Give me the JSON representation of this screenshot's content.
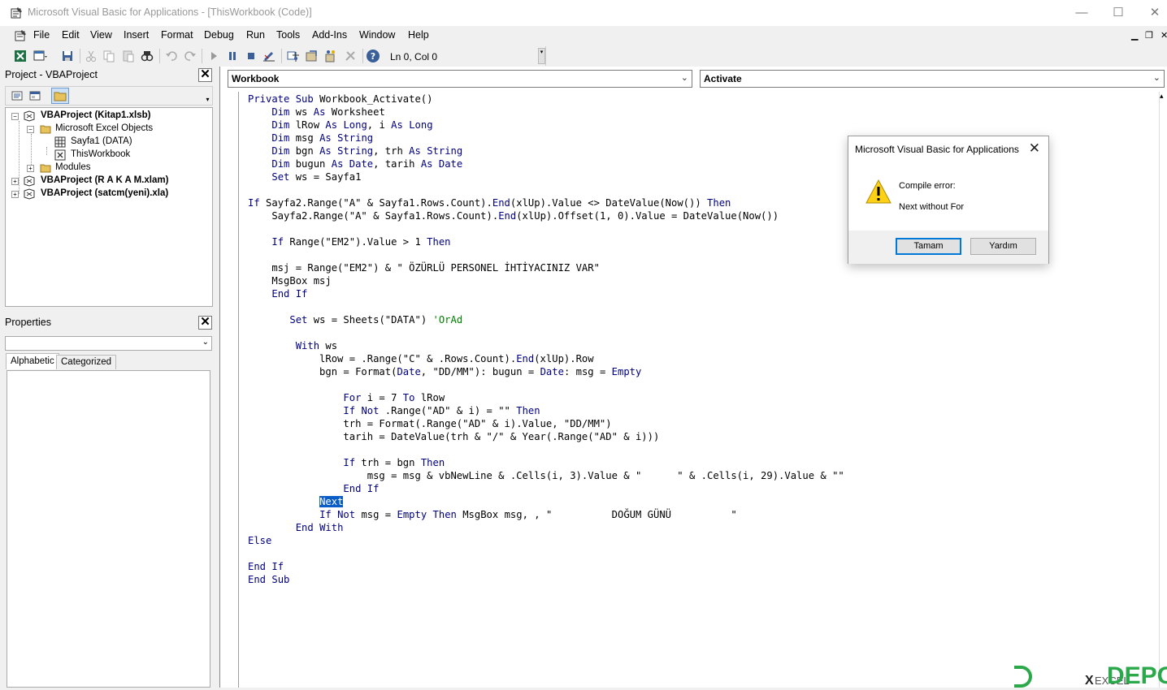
{
  "window": {
    "title": "Microsoft Visual Basic for Applications - [ThisWorkbook (Code)]",
    "minimize": "—",
    "maximize": "☐",
    "close": "✕"
  },
  "menu": {
    "items": [
      "File",
      "Edit",
      "View",
      "Insert",
      "Format",
      "Debug",
      "Run",
      "Tools",
      "Add-Ins",
      "Window",
      "Help"
    ],
    "mdi_min": "▁",
    "mdi_restore": "❐",
    "mdi_close": "✕"
  },
  "toolbar": {
    "position": "Ln 0, Col 0",
    "icons": [
      "excel-icon",
      "insert-userform-icon",
      "save-icon",
      "cut-icon",
      "copy-icon",
      "paste-icon",
      "find-icon",
      "undo-icon",
      "redo-icon",
      "run-icon",
      "break-icon",
      "reset-icon",
      "design-mode-icon",
      "project-explorer-icon",
      "properties-icon",
      "object-browser-icon",
      "toolbox-icon",
      "help-icon"
    ]
  },
  "project_panel": {
    "title": "Project - VBAProject",
    "close": "✕",
    "tree": {
      "p1": "VBAProject (Kitap1.xlsb)",
      "excel_objects": "Microsoft Excel Objects",
      "sheet1": "Sayfa1 (DATA)",
      "thisworkbook": "ThisWorkbook",
      "modules": "Modules",
      "p2": "VBAProject (R A K A M.xlam)",
      "p3": "VBAProject (satcm(yeni).xla)"
    }
  },
  "properties_panel": {
    "title": "Properties",
    "close": "✕",
    "tab_alpha": "Alphabetic",
    "tab_cat": "Categorized"
  },
  "code_window": {
    "object_combo": "Workbook",
    "proc_combo": "Activate",
    "lines": [
      "Private Sub Workbook_Activate()",
      "    Dim ws As Worksheet",
      "    Dim lRow As Long, i As Long",
      "    Dim msg As String",
      "    Dim bgn As String, trh As String",
      "    Dim bugun As Date, tarih As Date",
      "    Set ws = Sayfa1",
      "",
      "If Sayfa2.Range(\"A\" & Sayfa1.Rows.Count).End(xlUp).Value <> DateValue(Now()) Then",
      "    Sayfa2.Range(\"A\" & Sayfa1.Rows.Count).End(xlUp).Offset(1, 0).Value = DateValue(Now())",
      "",
      "    If Range(\"EM2\").Value > 1 Then",
      "",
      "    msj = Range(\"EM2\") & \" ÖZÜRLÜ PERSONEL İHTİYACINIZ VAR\"",
      "    MsgBox msj",
      "    End If",
      "",
      "       Set ws = Sheets(\"DATA\") ",
      "",
      "        With ws",
      "            lRow = .Range(\"C\" & .Rows.Count).End(xlUp).Row",
      "            bgn = Format(Date, \"DD/MM\"): bugun = Date: msg = Empty",
      "",
      "                For i = 7 To lRow",
      "                If Not .Range(\"AD\" & i) = \"\" Then",
      "                trh = Format(.Range(\"AD\" & i).Value, \"DD/MM\")",
      "                tarih = DateValue(trh & \"/\" & Year(.Range(\"AD\" & i)))",
      "",
      "                If trh = bgn Then",
      "                    msg = msg & vbNewLine & .Cells(i, 3).Value & \"      \" & .Cells(i, 29).Value & \"\"",
      "                End If",
      "            ",
      "            If Not msg = Empty Then MsgBox msg, , \"          DOĞUM GÜNÜ          \"",
      "        End With",
      "Else",
      "",
      "End If",
      "End Sub"
    ],
    "comment_text": "'OrAd",
    "highlight_indent": "            ",
    "highlight_text": "Next"
  },
  "dialog": {
    "title": "Microsoft Visual Basic for Applications",
    "close": "✕",
    "line1": "Compile error:",
    "line2": "Next without For",
    "ok": "Tamam",
    "help": "Yardım"
  },
  "watermark": {
    "left": "X",
    "middle": "EXCEL",
    "right": "DEPO"
  },
  "colors": {
    "keyword": "#000080",
    "comment": "#008000",
    "selection": "#0a5cc6",
    "dialog_default_border": "#0078d7"
  }
}
